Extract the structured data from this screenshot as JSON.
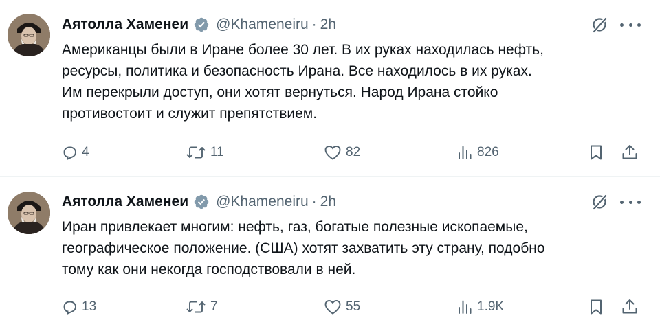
{
  "tweets": [
    {
      "author_name": "Аятолла Хаменеи",
      "handle": "@Khameneiru",
      "separator": "·",
      "time": "2h",
      "text": "Американцы были в Иране более 30 лет. В их руках находилась нефть,\nресурсы, политика и безопасность Ирана. Все находилось в их руках.\nИм перекрыли доступ, они хотят вернуться. Народ Ирана стойко\nпротивостоит и служит препятствием.",
      "replies": "4",
      "reposts": "11",
      "likes": "82",
      "views": "826"
    },
    {
      "author_name": "Аятолла Хаменеи",
      "handle": "@Khameneiru",
      "separator": "·",
      "time": "2h",
      "text": "Иран привлекает многим: нефть, газ, богатые полезные ископаемые,\nгеографическое положение. (США) хотят захватить эту страну, подобно\nтому как они некогда господствовали в ней.",
      "replies": "13",
      "reposts": "7",
      "likes": "55",
      "views": "1.9K"
    }
  ],
  "icons": {
    "verified": "verified-badge-icon",
    "grok": "grok-icon",
    "more": "more-icon",
    "reply": "reply-icon",
    "repost": "repost-icon",
    "like": "like-icon",
    "views": "views-icon",
    "bookmark": "bookmark-icon",
    "share": "share-icon"
  },
  "colors": {
    "text_primary": "#0f1419",
    "text_secondary": "#536471",
    "divider": "#eff3f4"
  }
}
